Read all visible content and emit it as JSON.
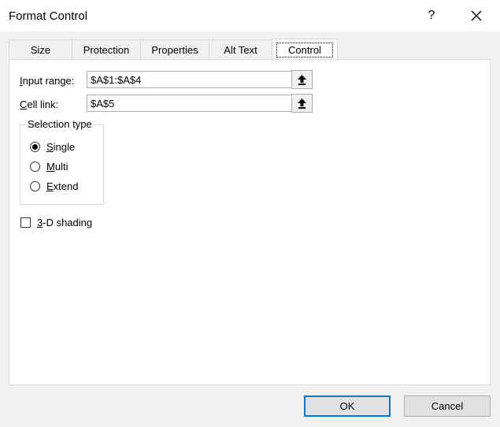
{
  "window": {
    "title": "Format Control",
    "help_label": "?",
    "close_icon": "close-icon"
  },
  "tabs": [
    {
      "label": "Size"
    },
    {
      "label": "Protection"
    },
    {
      "label": "Properties"
    },
    {
      "label": "Alt Text"
    },
    {
      "label": "Control",
      "active": true
    }
  ],
  "control": {
    "input_range": {
      "label_first": "I",
      "label_rest": "nput range:",
      "value": "$A$1:$A$4"
    },
    "cell_link": {
      "label_first": "C",
      "label_rest": "ell link:",
      "value": "$A$5"
    },
    "collapse_icon": "upload-arrow-icon",
    "selection_type": {
      "legend": "Selection type",
      "options": [
        {
          "first": "S",
          "rest": "ingle",
          "checked": true
        },
        {
          "first": "M",
          "rest": "ulti",
          "checked": false
        },
        {
          "first": "E",
          "rest": "xtend",
          "checked": false
        }
      ]
    },
    "shading": {
      "first": "3",
      "rest": "-D shading",
      "checked": false
    }
  },
  "buttons": {
    "ok": "OK",
    "cancel": "Cancel"
  },
  "colors": {
    "accent": "#0078d7",
    "dialog_bg": "#f0f0f0",
    "panel_bg": "#ffffff"
  }
}
